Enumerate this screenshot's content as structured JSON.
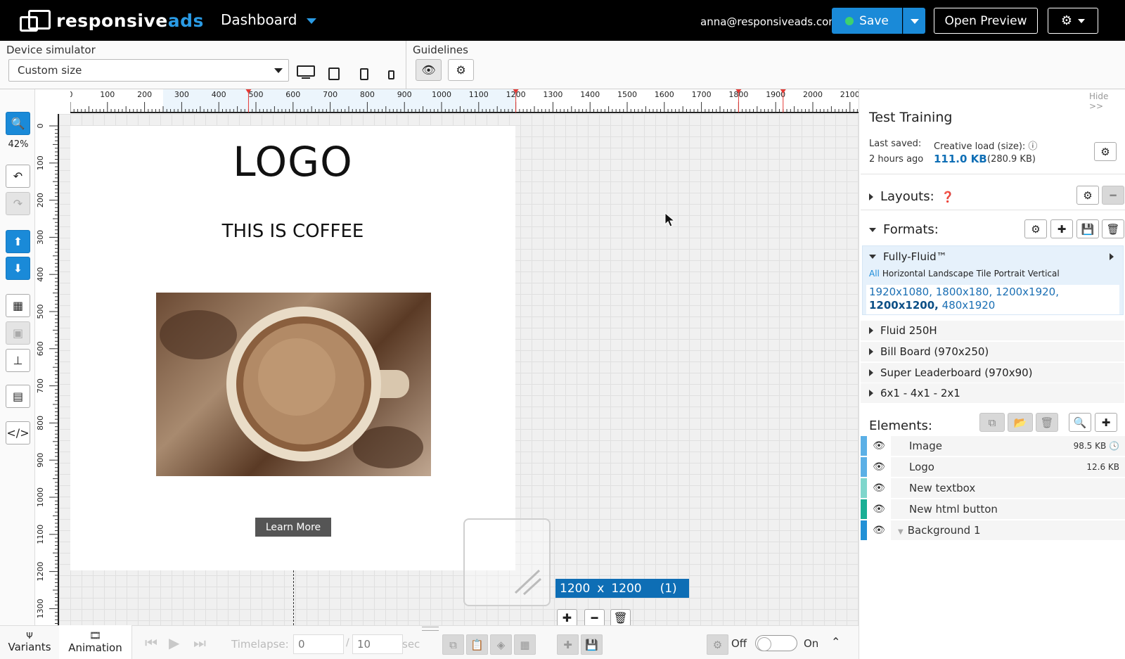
{
  "header": {
    "brand_main": "responsive",
    "brand_accent": "ads",
    "dashboard_label": "Dashboard",
    "user_email": "anna@responsiveads.com",
    "save_label": "Save",
    "preview_label": "Open Preview"
  },
  "toolbar": {
    "device_label": "Device simulator",
    "device_value": "Custom size",
    "guidelines_label": "Guidelines"
  },
  "left_tools": {
    "zoom": "42%"
  },
  "rulers": {
    "top_ticks": [
      "0",
      "100",
      "200",
      "300",
      "400",
      "500",
      "600",
      "700",
      "800",
      "900",
      "1000",
      "1100",
      "1200",
      "1300",
      "1400",
      "1500",
      "1600",
      "1700",
      "1800",
      "1900",
      "2000",
      "2100"
    ],
    "left_ticks": [
      "0",
      "100",
      "200",
      "300",
      "400",
      "500",
      "600",
      "700",
      "800",
      "900",
      "1000",
      "1100",
      "1200",
      "1300"
    ]
  },
  "canvas": {
    "ad_logo": "LOGO",
    "ad_subtitle": "THIS IS COFFEE",
    "ad_button": "Learn More",
    "size_w": "1200",
    "size_x": "x",
    "size_h": "1200",
    "size_count": "(1)"
  },
  "bottom": {
    "tab_variants": "Variants",
    "tab_animation": "Animation",
    "timelapse_label": "Timelapse:",
    "timelapse_value": "0",
    "timelapse_sep": "/",
    "timelapse_total": "10",
    "timelapse_unit": "sec",
    "off_label": "Off",
    "on_label": "On"
  },
  "panel": {
    "hide_label": "Hide >>",
    "project_title": "Test Training",
    "last_saved_label": "Last saved:",
    "last_saved_value": "2 hours ago",
    "load_label": "Creative load (size):",
    "load_value": "111.0 KB",
    "load_raw": "(280.9 KB)",
    "layouts_label": "Layouts:",
    "formats_label": "Formats:",
    "fully_fluid": "Fully-Fluid™",
    "filters": [
      "All",
      "Horizontal",
      "Landscape",
      "Tile",
      "Portrait",
      "Vertical"
    ],
    "sizes_before": "1920x1080, 1800x180, 1200x1920,",
    "sizes_bold": "1200x1200,",
    "sizes_after": "480x1920",
    "formats": [
      "Fluid 250H",
      "Bill Board (970x250)",
      "Super Leaderboard (970x90)",
      "6x1 - 4x1 - 2x1"
    ],
    "elements_label": "Elements:",
    "elements": [
      {
        "name": "Image",
        "size": "98.5 KB",
        "color": "#5bb0e6"
      },
      {
        "name": "Logo",
        "size": "12.6 KB",
        "color": "#5bb0e6"
      },
      {
        "name": "New textbox",
        "size": "",
        "color": "#7fd6cc"
      },
      {
        "name": "New html button",
        "size": "",
        "color": "#1aaf95"
      },
      {
        "name": "Background 1",
        "size": "",
        "color": "#2291d6"
      }
    ]
  },
  "colors": {
    "accent": "#1a8ad8",
    "badge": "#0e6eb5",
    "header_bg": "#000000"
  }
}
